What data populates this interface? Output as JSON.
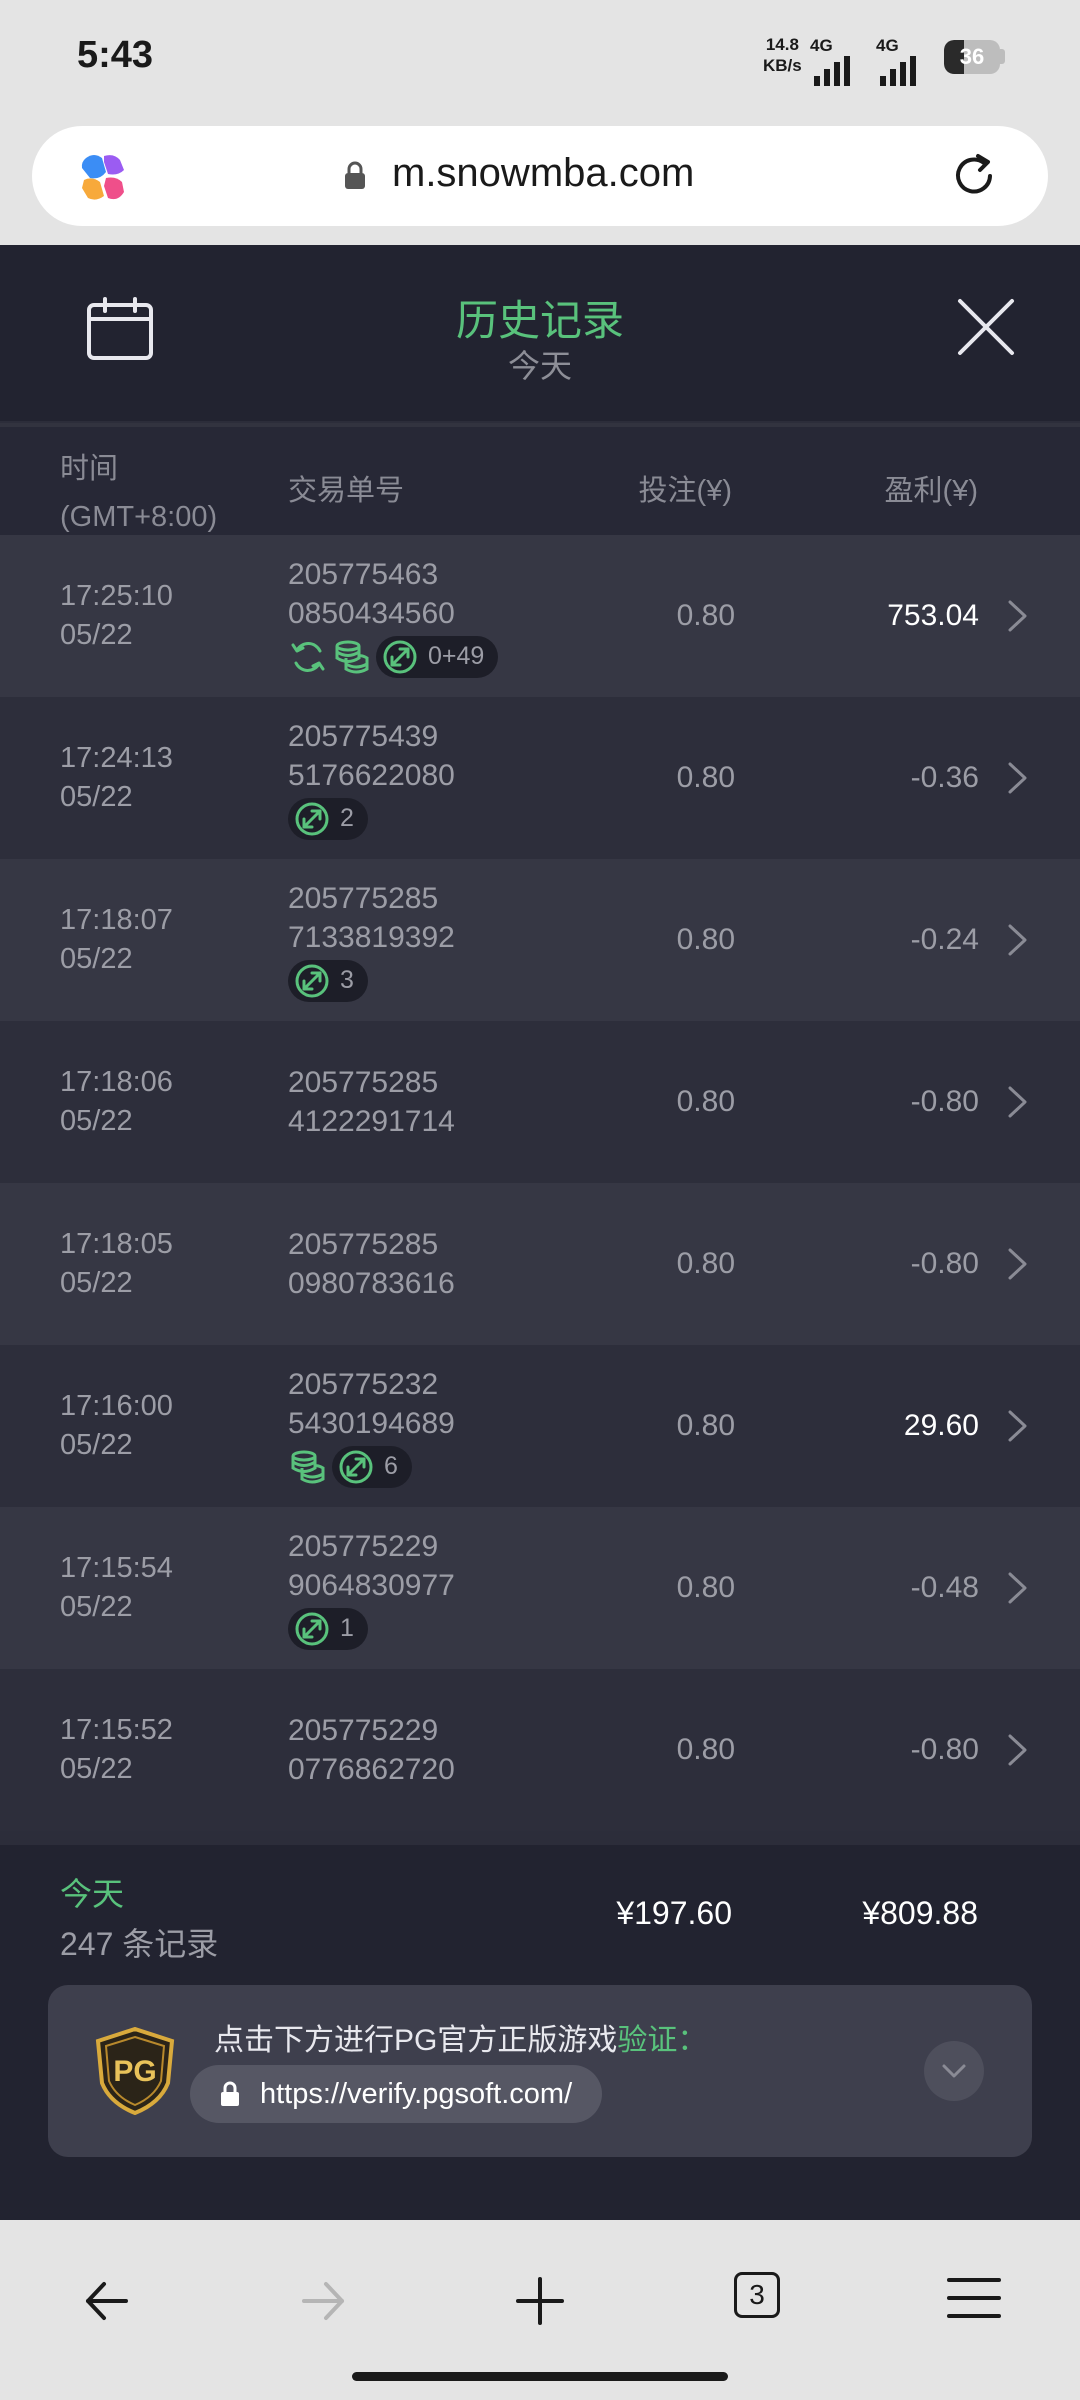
{
  "status_bar": {
    "time": "5:43",
    "net_speed_value": "14.8",
    "net_speed_unit": "KB/s",
    "sim1_label": "4G",
    "sim2_label": "4G",
    "battery": "36"
  },
  "browser": {
    "url": "m.snowmba.com",
    "tab_count": "3"
  },
  "header": {
    "title": "历史记录",
    "subtitle": "今天"
  },
  "columns": {
    "time": "时间",
    "timezone": "(GMT+8:00)",
    "order_id": "交易单号",
    "bet": "投注(¥)",
    "profit": "盈利(¥)"
  },
  "rows": [
    {
      "time": "17:25:10",
      "date": "05/22",
      "id1": "205775463",
      "id2": "0850434560",
      "bet": "0.80",
      "profit": "753.04",
      "tags": [
        "respin-icon",
        "coins-icon"
      ],
      "pill": "0+49"
    },
    {
      "time": "17:24:13",
      "date": "05/22",
      "id1": "205775439",
      "id2": "5176622080",
      "bet": "0.80",
      "profit": "-0.36",
      "tags": [],
      "pill": "2"
    },
    {
      "time": "17:18:07",
      "date": "05/22",
      "id1": "205775285",
      "id2": "7133819392",
      "bet": "0.80",
      "profit": "-0.24",
      "tags": [],
      "pill": "3"
    },
    {
      "time": "17:18:06",
      "date": "05/22",
      "id1": "205775285",
      "id2": "4122291714",
      "bet": "0.80",
      "profit": "-0.80",
      "tags": [],
      "pill": ""
    },
    {
      "time": "17:18:05",
      "date": "05/22",
      "id1": "205775285",
      "id2": "0980783616",
      "bet": "0.80",
      "profit": "-0.80",
      "tags": [],
      "pill": ""
    },
    {
      "time": "17:16:00",
      "date": "05/22",
      "id1": "205775232",
      "id2": "5430194689",
      "bet": "0.80",
      "profit": "29.60",
      "tags": [
        "coins-icon"
      ],
      "pill": "6"
    },
    {
      "time": "17:15:54",
      "date": "05/22",
      "id1": "205775229",
      "id2": "9064830977",
      "bet": "0.80",
      "profit": "-0.48",
      "tags": [],
      "pill": "1"
    },
    {
      "time": "17:15:52",
      "date": "05/22",
      "id1": "205775229",
      "id2": "0776862720",
      "bet": "0.80",
      "profit": "-0.80",
      "tags": [],
      "pill": ""
    }
  ],
  "summary": {
    "label": "今天",
    "count": "247 条记录",
    "total_bet": "¥197.60",
    "total_profit": "¥809.88"
  },
  "verify": {
    "text": "点击下方进行PG官方正版游戏",
    "highlight": "验证：",
    "link": "https://verify.pgsoft.com/",
    "logo_text": "PG"
  },
  "colors": {
    "accent_green": "#59c27c",
    "panel_dark": "#222330",
    "row_odd": "#363744",
    "row_even": "#2d2e3b"
  }
}
